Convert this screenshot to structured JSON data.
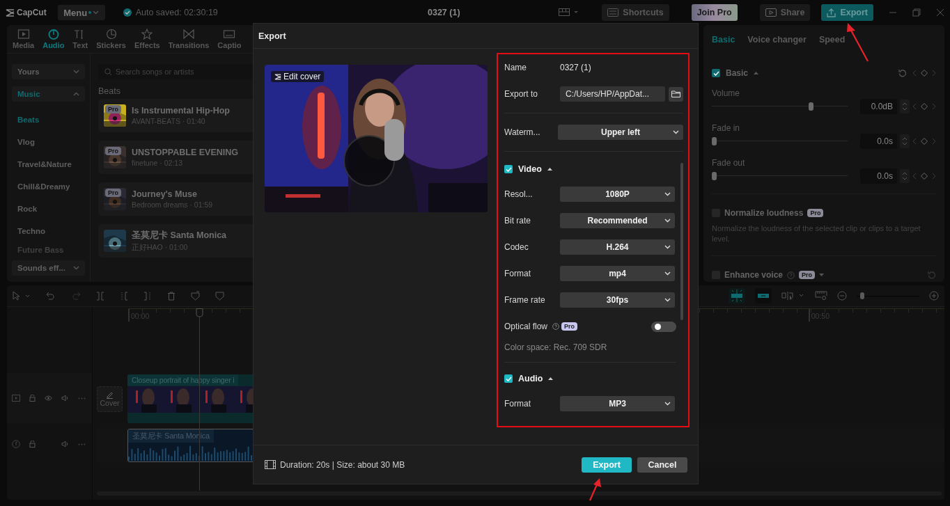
{
  "topbar": {
    "logo": "CapCut",
    "menu": "Menu",
    "autosave": "Auto saved: 02:30:19",
    "project": "0327 (1)",
    "buttons": [
      {
        "label": "Shortcuts",
        "kind": "plain"
      },
      {
        "label": "Join Pro",
        "kind": "pro"
      },
      {
        "label": "Share",
        "kind": "plain"
      },
      {
        "label": "Export",
        "kind": "primary"
      }
    ]
  },
  "tool_tabs": [
    {
      "label": "Media",
      "selected": false
    },
    {
      "label": "Audio",
      "selected": true
    },
    {
      "label": "Text",
      "selected": false
    },
    {
      "label": "Stickers",
      "selected": false
    },
    {
      "label": "Effects",
      "selected": false
    },
    {
      "label": "Transitions",
      "selected": false
    },
    {
      "label": "Captio",
      "selected": false
    }
  ],
  "sidebar": [
    {
      "label": "Yours",
      "kind": "group",
      "selected": false,
      "expanded": false
    },
    {
      "label": "Music",
      "kind": "group",
      "selected": true,
      "expanded": true
    },
    {
      "label": "Beats",
      "kind": "item",
      "selected": true
    },
    {
      "label": "Vlog",
      "kind": "item",
      "selected": false
    },
    {
      "label": "Travel&Nature",
      "kind": "item",
      "selected": false
    },
    {
      "label": "Chill&Dreamy",
      "kind": "item",
      "selected": false
    },
    {
      "label": "Rock",
      "kind": "item",
      "selected": false
    },
    {
      "label": "Techno",
      "kind": "item",
      "selected": false
    },
    {
      "label": "Future Bass",
      "kind": "item",
      "selected": false
    },
    {
      "label": "Sounds eff...",
      "kind": "group",
      "selected": false,
      "expanded": false
    }
  ],
  "library": {
    "search": {
      "placeholder": "Search songs or artists"
    },
    "heading": "Beats",
    "tracks": [
      {
        "title": "Is Instrumental Hip-Hop",
        "meta": "AVANT-BEATS · 01:40",
        "badge": "Pro"
      },
      {
        "title": "UNSTOPPABLE EVENING",
        "meta": "finetune · 02:13",
        "badge": "Pro"
      },
      {
        "title": "Journey's Muse",
        "meta": "Bedroom dreams · 01:59",
        "badge": "Pro"
      },
      {
        "title": "圣莫尼卡 Santa Monica",
        "meta": "正好HAO · 01:00"
      }
    ]
  },
  "details": {
    "tabs": [
      {
        "label": "Basic",
        "selected": true
      },
      {
        "label": "Voice changer",
        "selected": false
      },
      {
        "label": "Speed",
        "selected": false
      }
    ],
    "section": {
      "label": "Basic",
      "checked": true,
      "expanded": true
    },
    "sliders": [
      {
        "label": "Volume",
        "level": 0.74,
        "value": "0.0dB"
      },
      {
        "label": "Fade in",
        "level": 0,
        "value": "0.0s"
      },
      {
        "label": "Fade out",
        "level": 0,
        "value": "0.0s"
      }
    ],
    "options": [
      {
        "label": "Normalize loudness",
        "checked": false,
        "help": false,
        "badge": "Pro",
        "description": "Normalize the loudness of the selected clip or clips to a target level."
      },
      {
        "label": "Enhance voice",
        "checked": false,
        "help": true,
        "expanded": false,
        "badge": "Pro"
      }
    ]
  },
  "timeline": {
    "ruler": [
      "00:00",
      "00:50"
    ],
    "zoom": {
      "level": 0.05
    },
    "cover": "Cover",
    "clips": [
      {
        "kind": "video",
        "label": "Closeup portrait of happy singer i"
      },
      {
        "kind": "audio",
        "label": "圣莫尼卡 Santa Monica"
      }
    ]
  },
  "export_dialog": {
    "title": "Export",
    "cover_label": "Edit cover",
    "fields": [
      {
        "kind": "text",
        "label": "Name",
        "value": "0327 (1)"
      },
      {
        "kind": "path",
        "label": "Export to",
        "value": "C:/Users/HP/AppDat..."
      }
    ],
    "watermark": {
      "label": "Waterm...",
      "value": "Upper left"
    },
    "sections": [
      {
        "label": "Video",
        "checked": true,
        "expanded": true,
        "rows": [
          {
            "kind": "select",
            "label": "Resol...",
            "value": "1080P"
          },
          {
            "kind": "select",
            "label": "Bit rate",
            "value": "Recommended"
          },
          {
            "kind": "select",
            "label": "Codec",
            "value": "H.264"
          },
          {
            "kind": "select",
            "label": "Format",
            "value": "mp4"
          },
          {
            "kind": "select",
            "label": "Frame rate",
            "value": "30fps"
          },
          {
            "kind": "toggle",
            "label": "Optical flow",
            "on": false,
            "badge": "Pro"
          },
          {
            "kind": "note",
            "label": "Color space: Rec. 709 SDR"
          }
        ]
      },
      {
        "label": "Audio",
        "checked": true,
        "expanded": true,
        "rows": [
          {
            "kind": "select",
            "label": "Format",
            "value": "MP3"
          }
        ]
      }
    ],
    "summary": "Duration: 20s | Size: about 30 MB",
    "buttons": [
      {
        "label": "Export",
        "kind": "primary"
      },
      {
        "label": "Cancel",
        "kind": "secondary"
      }
    ]
  }
}
